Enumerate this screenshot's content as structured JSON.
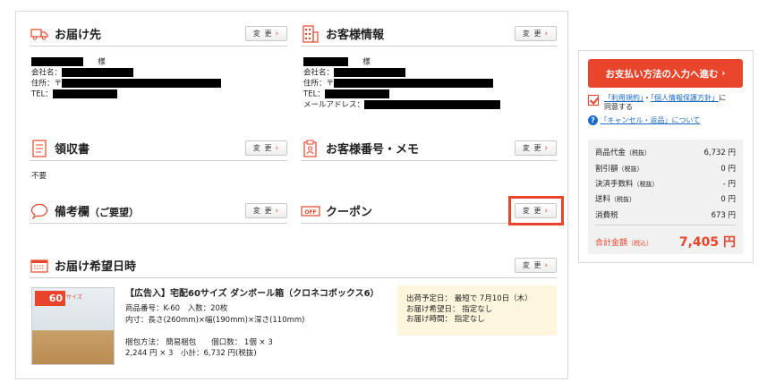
{
  "change_label": "変 更",
  "delivery": {
    "title": "お届け先",
    "name_suffix": "様",
    "company_label": "会社名：",
    "address_label": "住所：〒",
    "tel_label": "TEL："
  },
  "customer": {
    "title": "お客様情報",
    "name_suffix": "様",
    "company_label": "会社名：",
    "address_label": "住所：〒",
    "tel_label": "TEL：",
    "email_label": "メールアドレス："
  },
  "receipt": {
    "title": "領収書",
    "value": "不要"
  },
  "customer_number": {
    "title": "お客様番号・メモ"
  },
  "remarks": {
    "title": "備考欄",
    "subtitle": "（ご要望）"
  },
  "coupon": {
    "title": "クーポン",
    "icon_text": "OFF"
  },
  "delivery_date": {
    "title": "お届け希望日時"
  },
  "product": {
    "name": "【広告入】宅配60サイズ ダンボール箱（クロネコボックス6）",
    "code": "商品番号：K-60　入数：20枚",
    "dims": "内寸：長さ(260mm)×幅(190mm)×深さ(110mm)",
    "packing": "梱包方法：  簡易梱包　　個口数：  1個 × 3",
    "price": "2,244 円 × 3　小計：6,732 円(税抜)",
    "img_badge": "60",
    "img_size": "サイズ"
  },
  "shipping": {
    "line1": "出荷予定日：  最短で 7月10日（木）",
    "line2": "お届け希望日：  指定なし",
    "line3": "お届け時間：  指定なし"
  },
  "sidebar": {
    "pay_button": "お支払い方法の入力へ進む",
    "terms_link": "「利用規約」",
    "sep": "・",
    "privacy_link": "「個人情報保護方針」",
    "agree_suffix": "に",
    "agree_line2": "同意する",
    "cancel_link": "「キャンセル・返品」について",
    "summary": [
      {
        "label": "商品代金",
        "note": "（税抜）",
        "value": "6,732 円"
      },
      {
        "label": "割引額",
        "note": "（税抜）",
        "value": "0 円"
      },
      {
        "label": "決済手数料",
        "note": "（税抜）",
        "value": "- 円"
      },
      {
        "label": "送料",
        "note": "（税抜）",
        "value": "0 円"
      },
      {
        "label": "消費税",
        "note": "",
        "value": "673 円"
      }
    ],
    "total_label": "合計金額",
    "total_note": "（税込）",
    "total_value": "7,405 円"
  },
  "colors": {
    "accent": "#e8452c",
    "link": "#1a6bc9",
    "ship_bg": "#fdf6dc"
  }
}
